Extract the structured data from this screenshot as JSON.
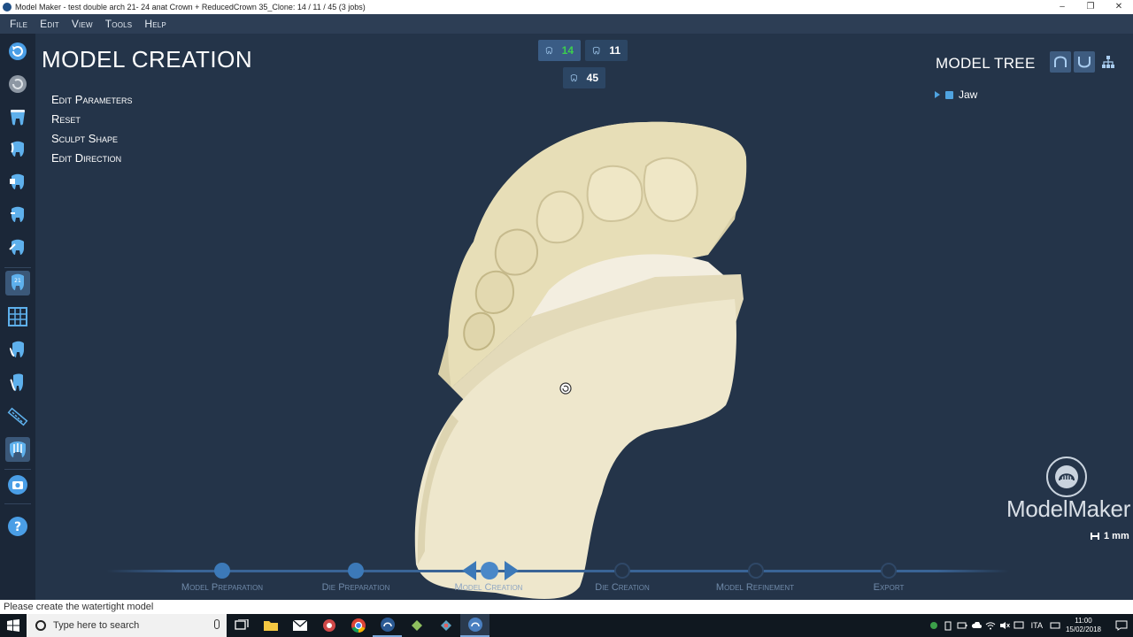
{
  "window": {
    "title": "Model Maker - test double arch  21- 24 anat Crown + ReducedCrown 35_Clone: 14 / 11 / 45 (3 jobs)",
    "controls": [
      "–",
      "❐",
      "✕"
    ]
  },
  "menu": [
    "File",
    "Edit",
    "View",
    "Tools",
    "Help"
  ],
  "toolbar": [
    "refresh-icon",
    "refresh-disabled-icon",
    "tooth-top-icon",
    "tooth-blue-1-icon",
    "tooth-blue-2-icon",
    "tooth-blue-3-icon",
    "tooth-blue-4-icon",
    "tooth-number-icon",
    "grid-icon",
    "tooth-implant-icon",
    "tooth-root-icon",
    "ruler-icon",
    "tooth-active-icon",
    "camera-icon",
    "help-icon"
  ],
  "page": {
    "title": "MODEL CREATION",
    "actions": [
      "Edit Parameters",
      "Reset",
      "Sculpt Shape",
      "Edit Direction"
    ]
  },
  "counters": [
    {
      "value": "14",
      "color": "#3ccf4e",
      "highlight": true
    },
    {
      "value": "11",
      "color": "#ffffff",
      "highlight": false
    },
    {
      "value": "45",
      "color": "#ffffff",
      "highlight": false
    }
  ],
  "model_tree": {
    "title": "MODEL TREE",
    "node": "Jaw",
    "buttons": [
      "upper-jaw-icon",
      "lower-jaw-icon",
      "hierarchy-icon"
    ]
  },
  "brand": {
    "name": "ModelMaker",
    "scale": "1 mm"
  },
  "workflow": {
    "steps": [
      {
        "label": "Model Preparation",
        "state": "done"
      },
      {
        "label": "Die Preparation",
        "state": "done"
      },
      {
        "label": "Model Creation",
        "state": "current"
      },
      {
        "label": "Die Creation",
        "state": "todo"
      },
      {
        "label": "Model Refinement",
        "state": "todo"
      },
      {
        "label": "Export",
        "state": "todo"
      }
    ]
  },
  "status": "Please create the watertight model",
  "taskbar": {
    "search_placeholder": "Type here to search",
    "apps": [
      "task-view-icon",
      "file-explorer-icon",
      "mail-icon",
      "settings-app-icon",
      "chrome-icon",
      "modelmaker-app-icon",
      "dental-app-1-icon",
      "dental-app-2-icon",
      "modelmaker-active-icon"
    ],
    "language": "ITA",
    "time": "11:00",
    "date": "15/02/2018"
  },
  "colors": {
    "background": "#243449",
    "accent": "#3c79b8",
    "model": "#eee7cc"
  }
}
